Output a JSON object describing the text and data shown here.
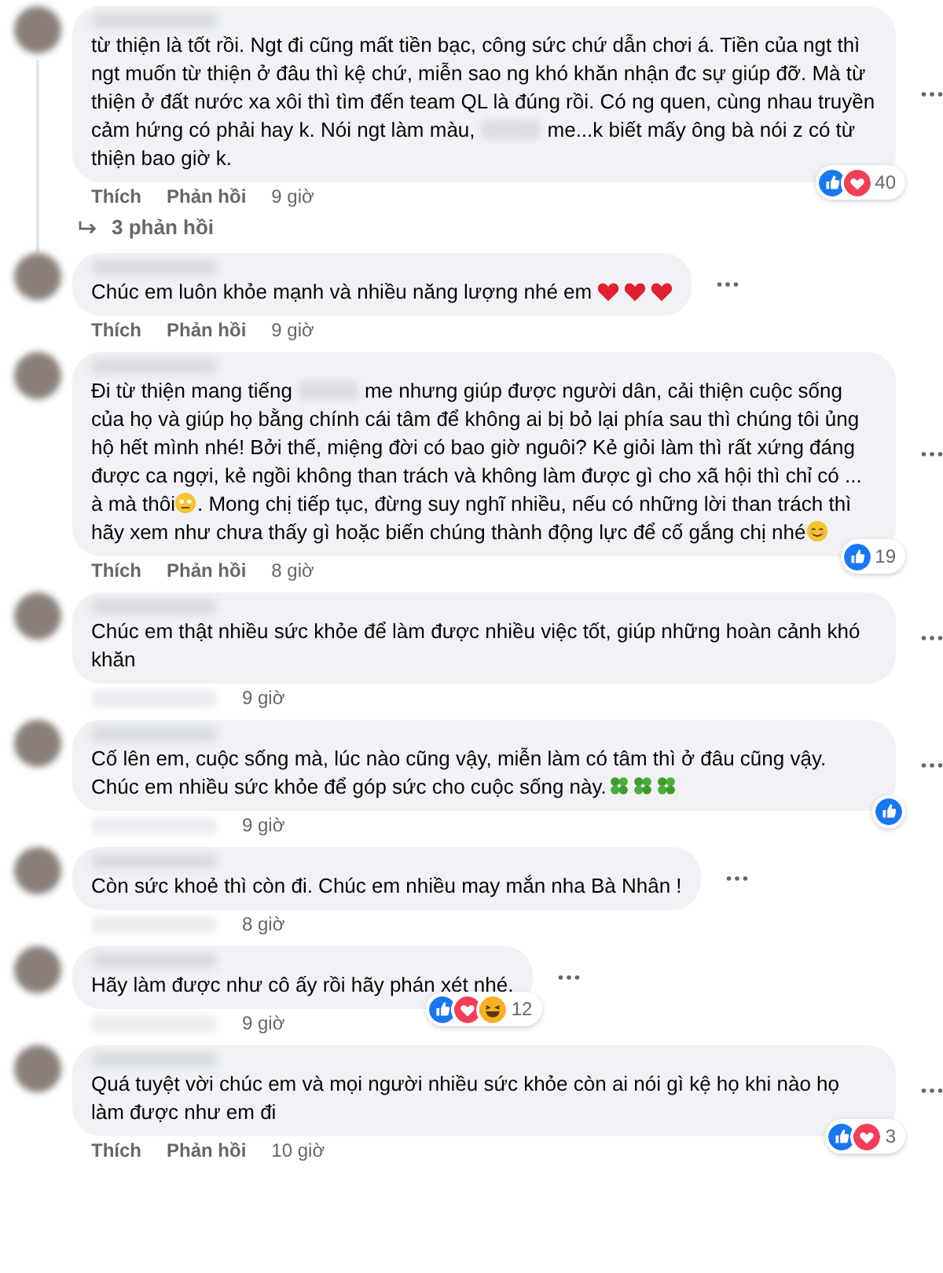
{
  "comments": [
    {
      "parts": [
        {
          "kind": "text",
          "text": "từ thiện là tốt rồi. Ngt đi cũng mất tiền bạc, công sức chứ dẫn chơi á. Tiền của ngt thì ngt muốn từ thiện ở đâu thì kệ chứ, miễn sao ng khó khăn nhận đc sự giúp đỡ. Mà từ thiện ở đất nước xa xôi thì tìm đến team QL là đúng rồi. Có ng quen, cùng nhau truyền cảm hứng có phải hay k. Nói ngt làm màu,"
        },
        {
          "kind": "blur"
        },
        {
          "kind": "text",
          "text": "me...k biết mấy ông bà nói z có từ thiện bao giờ k."
        }
      ],
      "actions": [
        "Thích",
        "Phản hồi"
      ],
      "time": "9 giờ",
      "reactions": {
        "items": [
          {
            "kind": "like"
          },
          {
            "kind": "love"
          }
        ],
        "count": "40"
      },
      "replies": "3 phản hồi"
    },
    {
      "parts": [
        {
          "kind": "text",
          "text": "Chúc em luôn khỏe mạnh và nhiều năng lượng nhé em"
        },
        {
          "kind": "heart"
        },
        {
          "kind": "heart"
        },
        {
          "kind": "heart"
        }
      ],
      "actions": [
        "Thích",
        "Phản hồi"
      ],
      "time": "9 giờ"
    },
    {
      "parts": [
        {
          "kind": "text",
          "text": "Đi từ thiện mang tiếng"
        },
        {
          "kind": "blur"
        },
        {
          "kind": "text",
          "text": "me nhưng giúp được người dân, cải thiện cuộc sống của họ và giúp họ bằng chính cái tâm để không ai bị bỏ lại phía sau thì chúng tôi ủng hộ hết mình nhé! Bởi thế, miệng đời có bao giờ nguôi? Kẻ giỏi làm thì rất xứng đáng được ca ngợi, kẻ ngồi không than trách và không làm được gì cho xã hội thì chỉ có ... à mà thôi"
        },
        {
          "kind": "worried"
        },
        {
          "kind": "text",
          "text": ". Mong chị tiếp tục, đừng suy nghĩ nhiều, nếu có những lời than trách thì hãy xem như chưa thấy gì hoặc biến chúng thành động lực để cố gắng chị nhé"
        },
        {
          "kind": "smile"
        }
      ],
      "actions": [
        "Thích",
        "Phản hồi"
      ],
      "time": "8 giờ",
      "reactions": {
        "items": [
          {
            "kind": "like"
          }
        ],
        "count": "19"
      }
    },
    {
      "parts": [
        {
          "kind": "text",
          "text": "Chúc em thật nhiều sức khỏe để làm được nhiều việc tốt, giúp những hoàn cảnh khó khăn"
        }
      ],
      "time": "9 giờ"
    },
    {
      "parts": [
        {
          "kind": "text",
          "text": "Cố lên em, cuộc sống mà, lúc nào cũng vậy, miễn làm có tâm thì ở đâu cũng vậy. Chúc em nhiều sức khỏe để góp sức cho cuộc sống này."
        },
        {
          "kind": "clover"
        },
        {
          "kind": "clover"
        },
        {
          "kind": "clover"
        }
      ],
      "time": "9 giờ",
      "reactions": {
        "items": [
          {
            "kind": "like"
          }
        ]
      }
    },
    {
      "parts": [
        {
          "kind": "text",
          "text": "Còn sức khoẻ thì còn đi. Chúc em nhiều may mắn nha Bà Nhân !"
        }
      ],
      "time": "8 giờ"
    },
    {
      "parts": [
        {
          "kind": "text",
          "text": "Hãy làm được như cô ấy rồi hãy phán xét nhé."
        }
      ],
      "time": "9 giờ",
      "reactions": {
        "items": [
          {
            "kind": "like"
          },
          {
            "kind": "love"
          },
          {
            "kind": "haha"
          }
        ],
        "count": "12"
      }
    },
    {
      "parts": [
        {
          "kind": "text",
          "text": "Quá tuyệt vời chúc em và mọi người nhiều sức khỏe còn ai nói gì kệ họ khi nào họ làm được như em đi"
        }
      ],
      "actions": [
        "Thích",
        "Phản hồi"
      ],
      "time": "10 giờ",
      "reactions": {
        "items": [
          {
            "kind": "like"
          },
          {
            "kind": "love"
          }
        ],
        "count": "3"
      }
    }
  ]
}
